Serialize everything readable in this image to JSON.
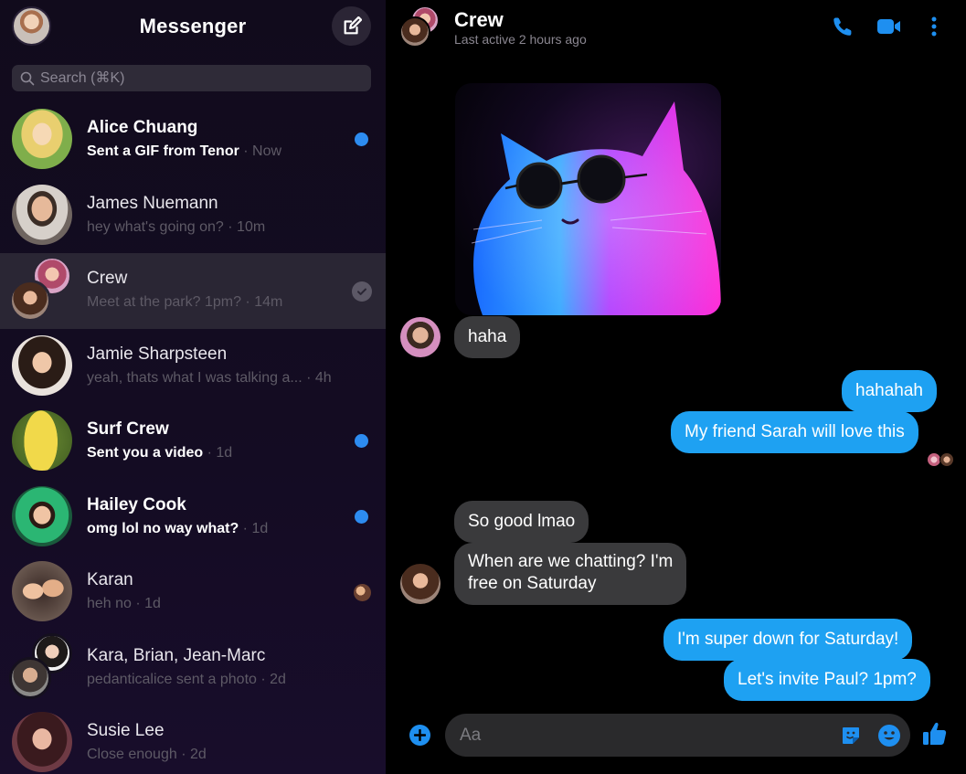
{
  "sidebar": {
    "title": "Messenger",
    "search_placeholder": "Search (⌘K)",
    "conversations": [
      {
        "name": "Alice Chuang",
        "snippet": "Sent a GIF from Tenor",
        "time": " · Now",
        "unread": true
      },
      {
        "name": "James Nuemann",
        "snippet": "hey what's going on?",
        "time": " · 10m",
        "unread": false
      },
      {
        "name": "Crew",
        "snippet": "Meet at the park? 1pm?",
        "time": " · 14m",
        "unread": false
      },
      {
        "name": "Jamie Sharpsteen",
        "snippet": "yeah, thats what I was talking a...",
        "time": " · 4h",
        "unread": false
      },
      {
        "name": "Surf Crew",
        "snippet": "Sent you a video",
        "time": " · 1d",
        "unread": true
      },
      {
        "name": "Hailey Cook",
        "snippet": "omg lol no way what?",
        "time": " · 1d",
        "unread": true
      },
      {
        "name": "Karan",
        "snippet": "heh no",
        "time": " · 1d",
        "unread": false
      },
      {
        "name": "Kara, Brian, Jean-Marc",
        "snippet": "pedanticalice sent a photo",
        "time": " · 2d",
        "unread": false
      },
      {
        "name": "Susie Lee",
        "snippet": "Close enough",
        "time": " · 2d",
        "unread": false
      }
    ]
  },
  "chat": {
    "title": "Crew",
    "status": "Last active 2 hours ago",
    "messages": [
      {
        "text": "haha",
        "direction": "in"
      },
      {
        "text": "hahahah",
        "direction": "out"
      },
      {
        "text": "My friend Sarah will love this",
        "direction": "out"
      },
      {
        "text": "So good lmao",
        "direction": "in"
      },
      {
        "text": "When are we chatting? I'm",
        "direction": "in"
      },
      {
        "text": "free on Saturday",
        "direction": "in"
      },
      {
        "text": "I'm super down for Saturday!",
        "direction": "out"
      },
      {
        "text": "Let's invite Paul? 1pm?",
        "direction": "out"
      }
    ],
    "composer_placeholder": "Aa"
  },
  "icons": {
    "compose": "compose-icon",
    "search": "search-icon",
    "phone": "phone-icon",
    "video": "video-camera-icon",
    "more": "more-vertical-icon",
    "plus": "plus-icon",
    "sticker": "sticker-icon",
    "emoji": "emoji-icon",
    "like": "thumbs-up-icon"
  },
  "colors": {
    "accent": "#1ea1f2",
    "unread_dot": "#2d8cf0",
    "incoming_bubble": "#3a3a3c",
    "sidebar_bg": "#140c23"
  }
}
